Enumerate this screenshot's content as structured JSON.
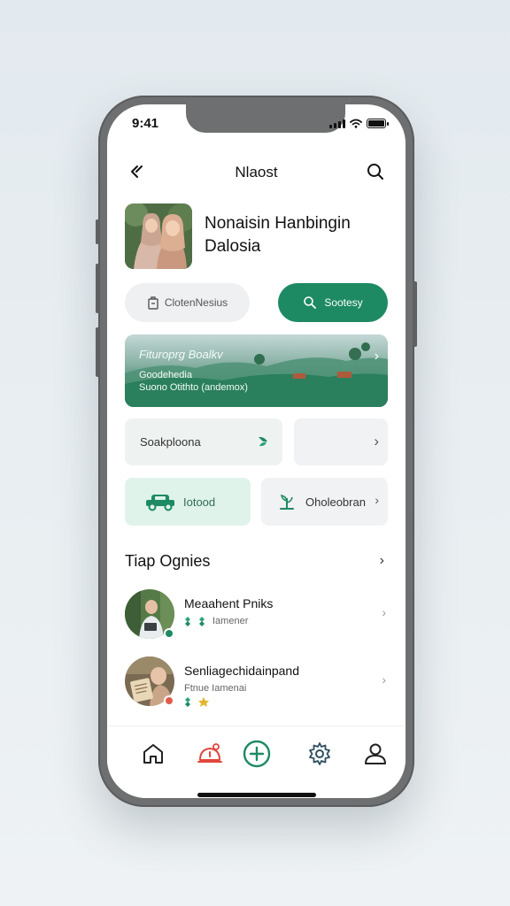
{
  "status_bar": {
    "time": "9:41"
  },
  "topbar": {
    "title": "Nlaost",
    "back_icon": "back-chevron-icon",
    "search_icon": "search-icon"
  },
  "profile": {
    "name": "Nonaisin Hanbingin Dalosia"
  },
  "actions": {
    "secondary_label": "ClotenNesius",
    "primary_label": "Sootesy",
    "primary_color": "#1e8a63"
  },
  "banner": {
    "title": "Fituroprg Boalkv",
    "line1": "Goodehedia",
    "line2": "Suono Otithto (andemox)"
  },
  "cards": {
    "card1_label": "Soakploona",
    "card3_label": "Iotood",
    "card4_label": "Oholeobran"
  },
  "section": {
    "title": "Tiap Ognies"
  },
  "list": [
    {
      "title": "Meaahent Pniks",
      "subtitle": "Iamener",
      "status_color": "#1e8a63"
    },
    {
      "title": "Senliagechidainpand",
      "subtitle": "Ftnue Iamenai",
      "status_color": "#e05a4a"
    }
  ],
  "tabbar": {
    "items": [
      {
        "icon": "home-icon"
      },
      {
        "icon": "alert-icon"
      },
      {
        "icon": "add-circle-icon"
      },
      {
        "icon": "settings-icon"
      },
      {
        "icon": "profile-icon"
      }
    ]
  }
}
